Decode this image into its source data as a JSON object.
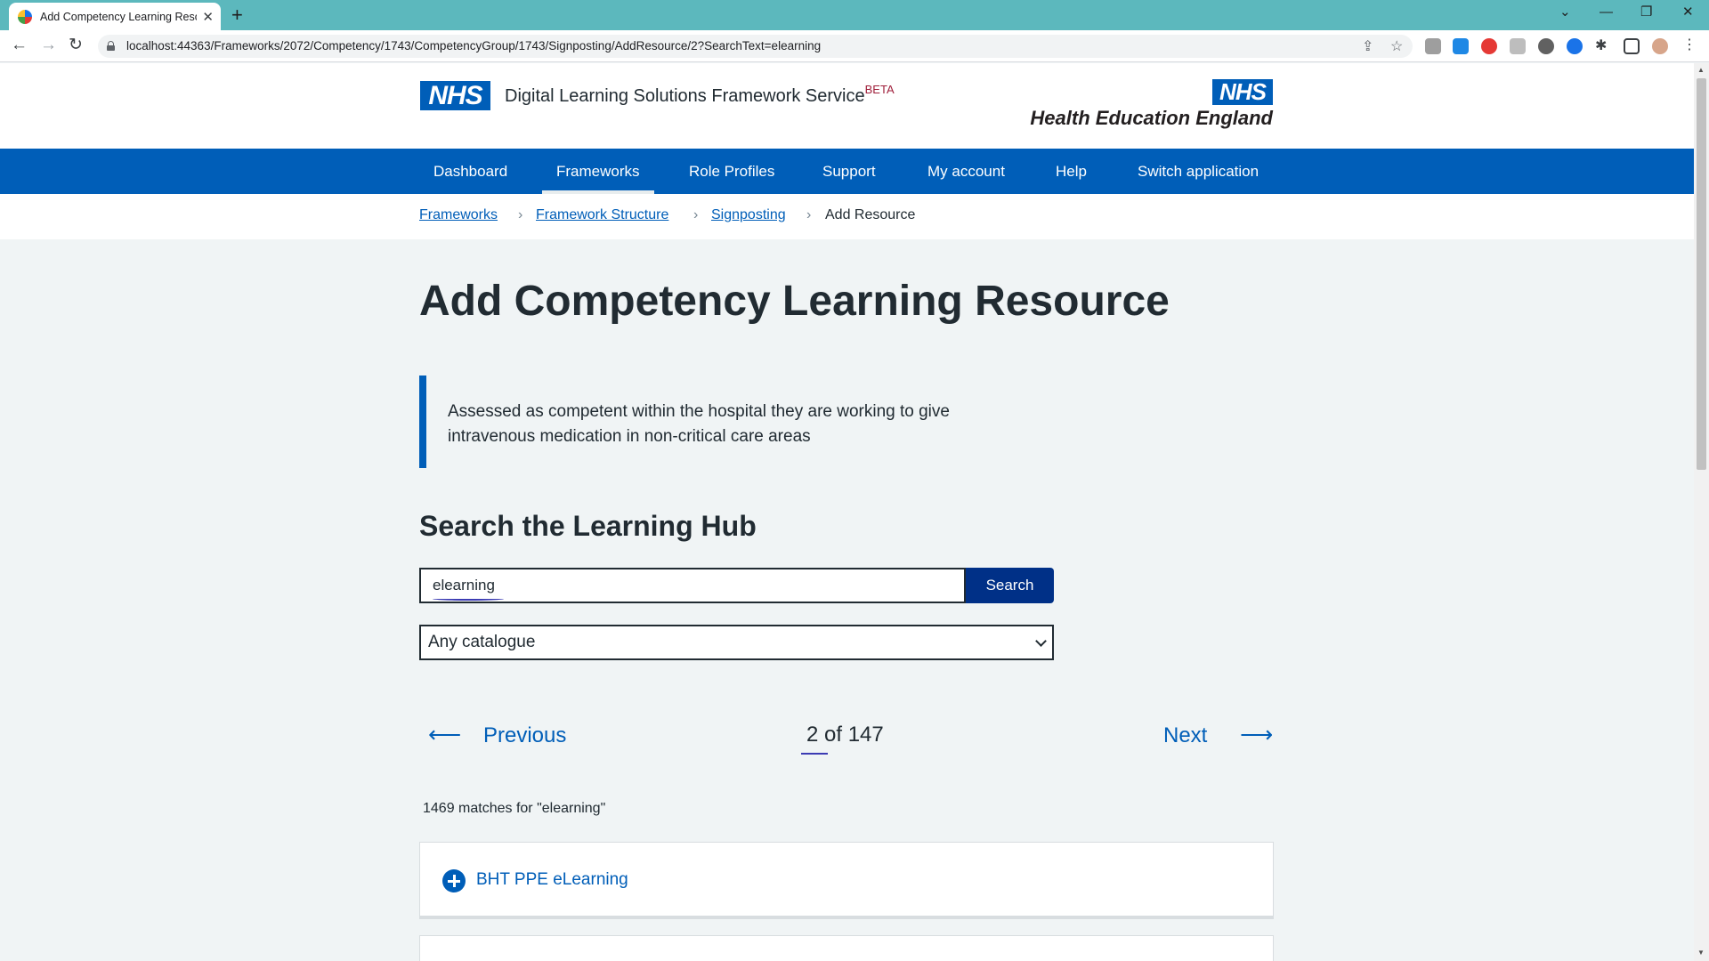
{
  "browser": {
    "tab_title": "Add Competency Learning Resou",
    "tab_close": "✕",
    "new_tab": "+",
    "url": "localhost:44363/Frameworks/2072/Competency/1743/CompetencyGroup/1743/Signposting/AddResource/2?SearchText=elearning",
    "window_controls": [
      "⌄",
      "—",
      "❐",
      "✕"
    ]
  },
  "header": {
    "nhs_logo": "NHS",
    "service_name": "Digital Learning Solutions Framework Service",
    "beta_tag": "BETA",
    "partner_logo": "NHS",
    "partner_name": "Health Education England"
  },
  "nav": {
    "items": [
      {
        "label": "Dashboard"
      },
      {
        "label": "Frameworks",
        "active": true
      },
      {
        "label": "Role Profiles"
      },
      {
        "label": "Support"
      },
      {
        "label": "My account"
      },
      {
        "label": "Help"
      },
      {
        "label": "Switch application"
      }
    ]
  },
  "breadcrumb": {
    "items": [
      "Frameworks",
      "Framework Structure",
      "Signposting"
    ],
    "current": "Add Resource"
  },
  "main": {
    "title": "Add Competency Learning Resource",
    "competency_description": "Assessed as competent within the hospital they are working to give intravenous medication in non-critical care areas",
    "search_heading": "Search the Learning Hub",
    "search_value": "elearning",
    "search_button": "Search",
    "catalogue_selected": "Any catalogue",
    "pagination": {
      "previous_label": "Previous",
      "next_label": "Next",
      "page_info": "2 of 147"
    },
    "match_summary": "1469 matches for \"elearning\"",
    "results": [
      {
        "title": "BHT PPE eLearning"
      }
    ]
  },
  "colors": {
    "nhs_blue": "#005eb8",
    "nhs_dark_blue": "#003087",
    "page_background": "#f0f4f5",
    "browser_frame": "#5cb8bd"
  }
}
